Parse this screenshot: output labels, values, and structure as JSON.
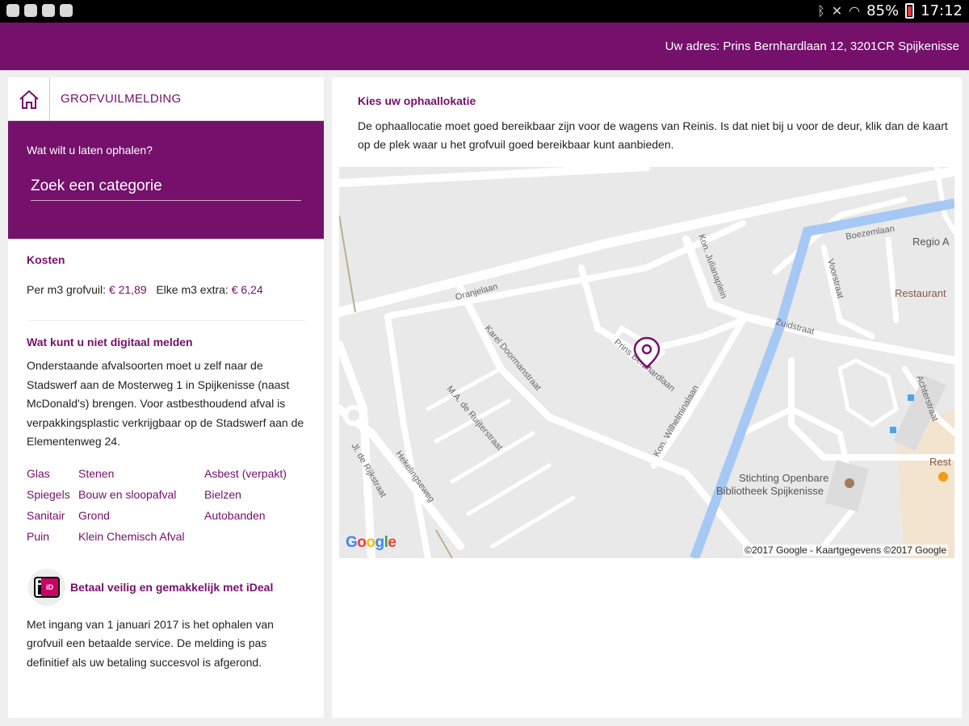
{
  "status_bar": {
    "battery": "85%",
    "time": "17:12"
  },
  "header": {
    "address": "Uw adres: Prins Bernhardlaan 12, 3201CR Spijkenisse"
  },
  "breadcrumb": {
    "title": "GROFVUILMELDING"
  },
  "search": {
    "question": "Wat wilt u laten ophalen?",
    "placeholder": "Zoek een categorie"
  },
  "kosten": {
    "title": "Kosten",
    "per_m3_label": "Per m3 grofvuil:",
    "per_m3_value": "€ 21,89",
    "extra_label": "Elke m3 extra:",
    "extra_value": "€ 6,24"
  },
  "niet_digitaal": {
    "title": "Wat kunt u niet digitaal melden",
    "text": "Onderstaande afvalsoorten moet u zelf naar de Stadswerf aan de Mosterweg 1 in Spijkenisse (naast McDonald's) brengen. Voor astbesthoudend afval is verpakkingsplastic verkrijgbaar op de Stadswerf aan de Elementenweg 24.",
    "items": [
      "Glas",
      "Stenen",
      "Asbest (verpakt)",
      "Spiegels",
      "Bouw en sloopafval",
      "Bielzen",
      "Sanitair",
      "Grond",
      "Autobanden",
      "Puin",
      "Klein Chemisch Afval",
      ""
    ]
  },
  "ideal": {
    "title": "Betaal veilig en gemakkelijk met iDeal",
    "text": "Met ingang van 1 januari 2017 is het ophalen van grofvuil een betaalde service. De melding is pas definitief als uw betaling succesvol is afgerond."
  },
  "locatie": {
    "title": "Kies uw ophaallokatie",
    "text": "De ophaallocatie moet goed bereikbaar zijn voor de wagens van Reinis. Is dat niet bij u voor de deur, klik dan de kaart op de plek waar u het grofvuil goed bereikbaar kunt aanbieden."
  },
  "map": {
    "labels": [
      "Oranjelaan",
      "Karel Doormanstraat",
      "M.A. de Ruijterstraat",
      "Prins Bernhardlaan",
      "Kon. Wilhelminalaan",
      "Jl. de Rijkstraat",
      "Hekelingseweg",
      "Kon. Julianaplein",
      "Zuidstraat",
      "Voorstraat",
      "Boezemlaan",
      "Regio A",
      "Restaurant",
      "Stichting Openbare",
      "Bibliotheek Spijkenisse",
      "Achterstraat",
      "Rest"
    ],
    "google": "Google",
    "copyright": "©2017 Google - Kaartgegevens ©2017 Google"
  },
  "colors": {
    "brand": "#75106b",
    "water": "#a6c8f5"
  }
}
